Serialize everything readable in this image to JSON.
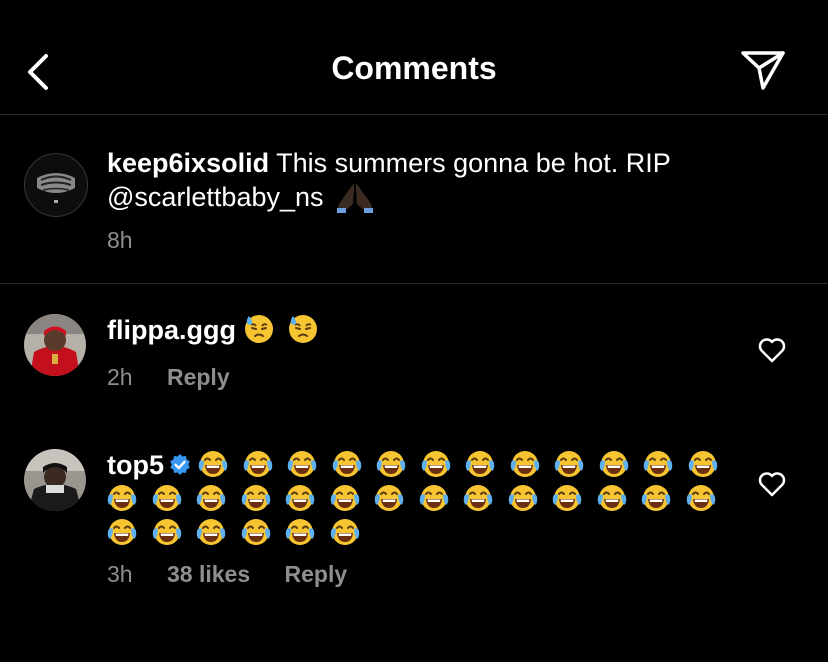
{
  "header": {
    "title": "Comments"
  },
  "post": {
    "username": "keep6ixsolid",
    "caption_line1": "This summers gonna be hot. RIP",
    "caption_mention": "@scarlettbaby_ns",
    "caption_emoji": "pray-emoji",
    "time": "8h"
  },
  "comments": [
    {
      "username": "flippa.ggg",
      "emoji": "downcast-sweat-emoji",
      "emoji_count": 2,
      "time": "2h",
      "reply_label": "Reply"
    },
    {
      "username": "top5",
      "verified": true,
      "emoji": "tears-of-joy-emoji",
      "emoji_count": 32,
      "time": "3h",
      "likes": "38 likes",
      "reply_label": "Reply"
    }
  ],
  "colors": {
    "background": "#000000",
    "secondary_text": "#8e8e8e",
    "verified": "#3897f0"
  }
}
